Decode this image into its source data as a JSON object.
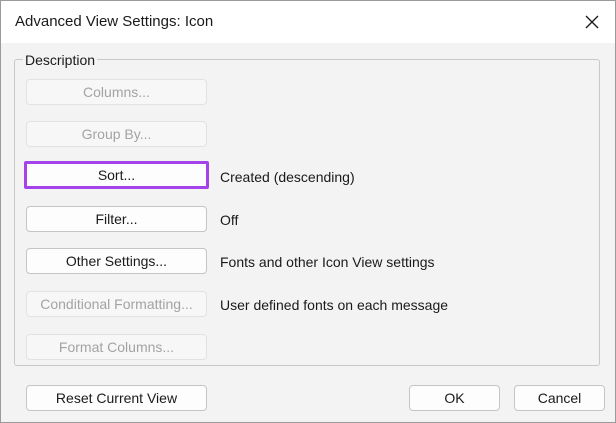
{
  "window": {
    "title": "Advanced View Settings: Icon",
    "close_icon": "close-icon"
  },
  "group": {
    "label": "Description"
  },
  "settings": {
    "columns": {
      "label": "Columns...",
      "enabled": false
    },
    "group_by": {
      "label": "Group By...",
      "enabled": false
    },
    "sort": {
      "label": "Sort...",
      "value": "Created (descending)",
      "enabled": true,
      "highlighted": true,
      "highlight_color": "#a543ea"
    },
    "filter": {
      "label": "Filter...",
      "value": "Off",
      "enabled": true
    },
    "other_settings": {
      "label": "Other Settings...",
      "value": "Fonts and other Icon View settings",
      "enabled": true
    },
    "conditional_formatting": {
      "label": "Conditional Formatting...",
      "value": "User defined fonts on each message",
      "enabled": false
    },
    "format_columns": {
      "label": "Format Columns...",
      "enabled": false
    }
  },
  "footer": {
    "reset_label": "Reset Current View",
    "ok_label": "OK",
    "cancel_label": "Cancel"
  }
}
